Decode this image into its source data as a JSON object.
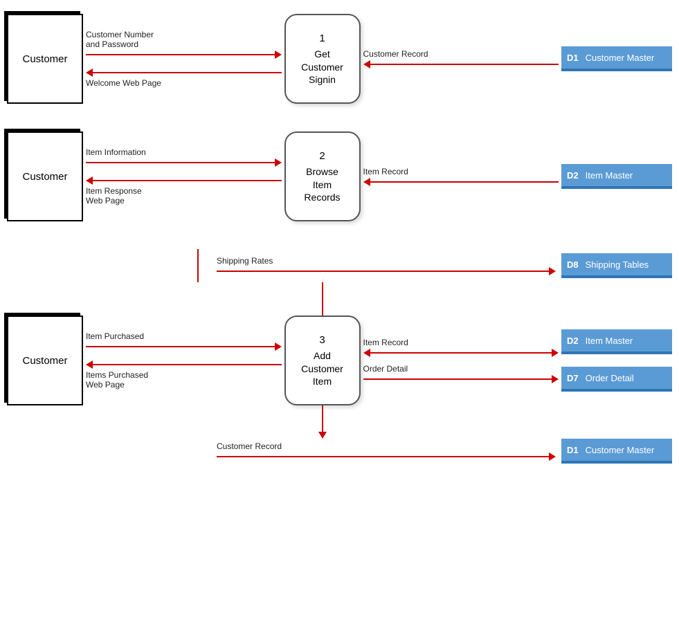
{
  "diagram": {
    "row1": {
      "entity": "Customer",
      "process_num": "1",
      "process_label": "Get\nCustomer\nSignin",
      "left_arrows": [
        {
          "label": "Customer Number\nand Password",
          "direction": "right"
        },
        {
          "label": "Welcome Web Page",
          "direction": "left"
        }
      ],
      "right_arrows": [
        {
          "label": "Customer Record",
          "direction": "left"
        }
      ],
      "data_stores": [
        {
          "id": "D1",
          "name": "Customer Master"
        }
      ]
    },
    "row2": {
      "entity": "Customer",
      "process_num": "2",
      "process_label": "Browse\nItem\nRecords",
      "left_arrows": [
        {
          "label": "Item Information",
          "direction": "right"
        },
        {
          "label": "Item Response\nWeb Page",
          "direction": "left"
        }
      ],
      "right_arrows": [
        {
          "label": "Item Record",
          "direction": "left"
        }
      ],
      "data_stores": [
        {
          "id": "D2",
          "name": "Item Master"
        }
      ]
    },
    "row3": {
      "entity": "Customer",
      "process_num": "3",
      "process_label": "Add\nCustomer\nItem",
      "left_arrows": [
        {
          "label": "Item Purchased",
          "direction": "right"
        },
        {
          "label": "Items Purchased\nWeb Page",
          "direction": "left"
        }
      ],
      "top_arrow": {
        "label": "Shipping Rates",
        "direction": "right"
      },
      "right_arrows": [
        {
          "label": "Item Record",
          "direction": "both"
        },
        {
          "label": "Order Detail",
          "direction": "right"
        }
      ],
      "bottom_arrow": {
        "label": "Customer Record",
        "direction": "right"
      },
      "data_stores_top": [
        {
          "id": "D8",
          "name": "Shipping Tables"
        }
      ],
      "data_stores_right": [
        {
          "id": "D2",
          "name": "Item Master"
        },
        {
          "id": "D7",
          "name": "Order Detail"
        }
      ],
      "data_stores_bottom": [
        {
          "id": "D1",
          "name": "Customer Master"
        }
      ]
    }
  }
}
